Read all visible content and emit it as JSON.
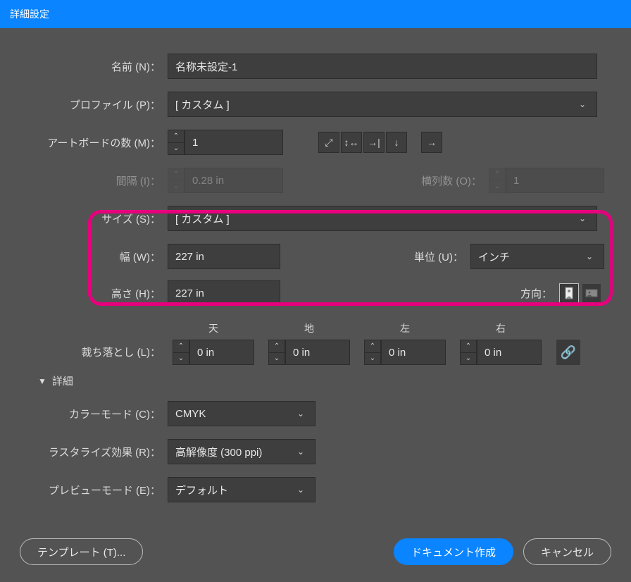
{
  "title": "詳細設定",
  "labels": {
    "name": "名前 (N)：",
    "profile": "プロファイル (P)：",
    "artboards": "アートボードの数 (M)：",
    "spacing": "間隔 (I)：",
    "columns": "横列数 (O)：",
    "size": "サイズ (S)：",
    "width": "幅 (W)：",
    "height": "高さ (H)：",
    "units": "単位 (U)：",
    "orientation": "方向：",
    "bleed": "裁ち落とし (L)：",
    "top": "天",
    "bottom": "地",
    "left": "左",
    "right": "右",
    "advanced": "詳細",
    "color_mode": "カラーモード (C)：",
    "raster": "ラスタライズ効果 (R)：",
    "preview": "プレビューモード (E)："
  },
  "values": {
    "name": "名称未設定-1",
    "profile": "[ カスタム ]",
    "artboards": "1",
    "spacing": "0.28 in",
    "columns": "1",
    "size": "[ カスタム ]",
    "width": "227 in",
    "height": "227 in",
    "units": "インチ",
    "bleed_top": "0 in",
    "bleed_bottom": "0 in",
    "bleed_left": "0 in",
    "bleed_right": "0 in",
    "color_mode": "CMYK",
    "raster": "高解像度 (300 ppi)",
    "preview": "デフォルト"
  },
  "buttons": {
    "templates": "テンプレート (T)...",
    "create": "ドキュメント作成",
    "cancel": "キャンセル"
  }
}
